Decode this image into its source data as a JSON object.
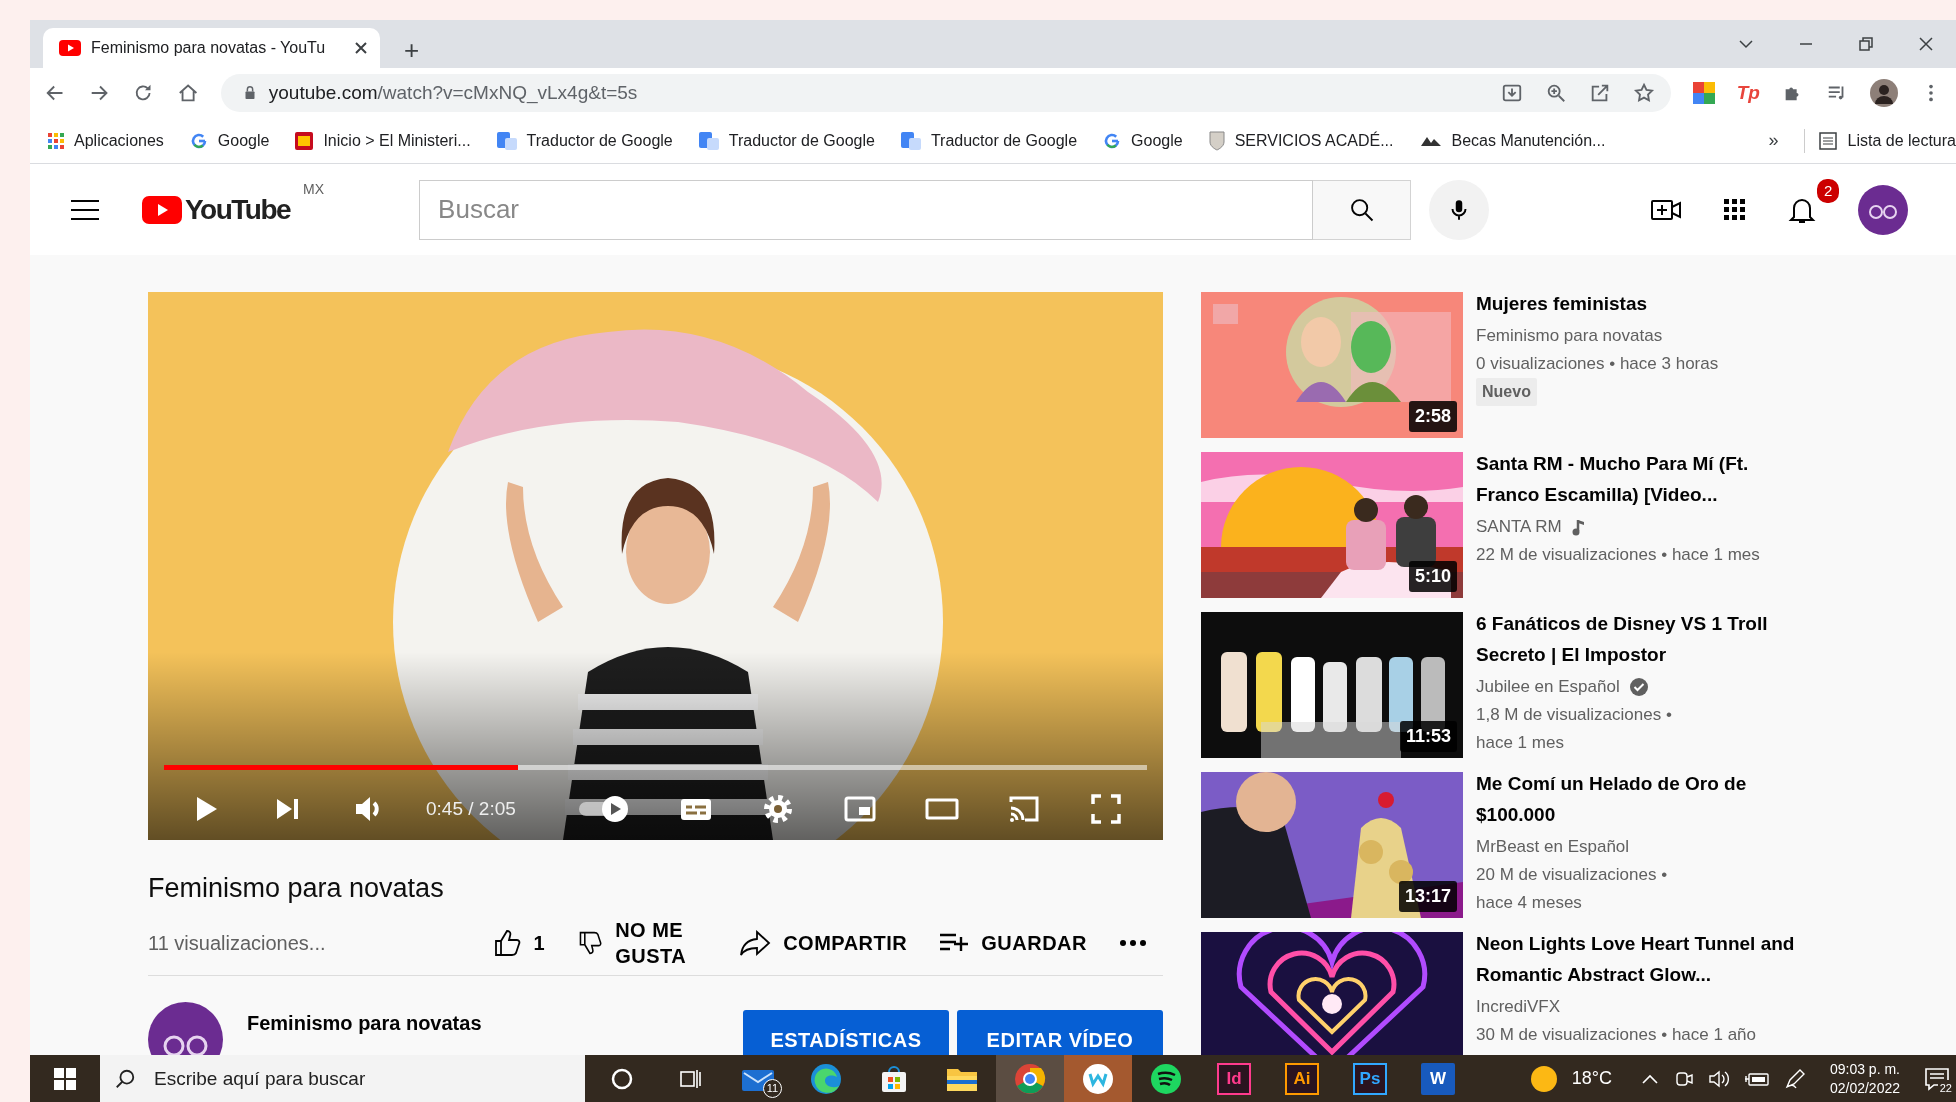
{
  "browser": {
    "tabs": [
      {
        "title": "Feminismo para novatas - YouTu",
        "selected": true
      }
    ],
    "new_tab": "+",
    "address": {
      "host": "youtube.com",
      "path": "/watch?v=cMxNQ_vLx4g&t=5s"
    },
    "extensions": [
      {
        "kind": "colors"
      },
      {
        "kind": "tp",
        "label": "Tp"
      },
      {
        "kind": "puzzle"
      },
      {
        "kind": "media"
      },
      {
        "kind": "avatar"
      }
    ],
    "bookmarks": [
      {
        "kind": "apps",
        "label": "Aplicaciones"
      },
      {
        "kind": "g",
        "label": "Google"
      },
      {
        "kind": "flag",
        "label": "Inicio > El Ministeri..."
      },
      {
        "kind": "doc",
        "label": "Traductor de Google"
      },
      {
        "kind": "doc",
        "label": "Traductor de Google"
      },
      {
        "kind": "doc",
        "label": "Traductor de Google"
      },
      {
        "kind": "g",
        "label": "Google"
      },
      {
        "kind": "crest",
        "label": "SERVICIOS ACADÉ..."
      },
      {
        "kind": "emblem",
        "label": "Becas Manutención..."
      }
    ],
    "more_bookmarks": "»",
    "reading_list": "Lista de lectura"
  },
  "youtube": {
    "logo": "YouTube",
    "region": "MX",
    "search": {
      "placeholder": "Buscar"
    },
    "notifications": "2"
  },
  "player": {
    "level": 0.36,
    "time": "0:45 / 2:05",
    "autoplay": true
  },
  "video": {
    "title": "Feminismo para novatas",
    "views": "11 visualizaciones...",
    "likes": "1",
    "dislike": "NO ME GUSTA",
    "share": "COMPARTIR",
    "save": "GUARDAR",
    "channel": "Feminismo para novatas",
    "buttons": [
      "ESTADÍSTICAS",
      "EDITAR VÍDEO"
    ]
  },
  "sidebar": [
    {
      "duration": "2:58",
      "title": "Mujeres feministas",
      "channel": "Feminismo para novatas",
      "kind": "plain",
      "meta": [
        "0 visualizaciones • hace 3 horas"
      ],
      "badge": "Nuevo"
    },
    {
      "duration": "5:10",
      "title": "Santa RM - Mucho Para Mí (Ft. Franco Escamilla) [Video...",
      "channel": "SANTA RM",
      "kind": "music",
      "meta": [
        "22 M de visualizaciones • hace 1 mes"
      ]
    },
    {
      "duration": "11:53",
      "title": "6 Fanáticos de Disney VS 1 Troll Secreto | El Impostor",
      "channel": "Jubilee en Español",
      "kind": "verified",
      "meta": [
        "1,8 M de visualizaciones •",
        "hace 1 mes"
      ]
    },
    {
      "duration": "13:17",
      "title": "Me Comí un Helado de Oro de $100.000",
      "channel": "MrBeast en Español",
      "kind": "plain",
      "meta": [
        "20 M de visualizaciones •",
        "hace 4 meses"
      ]
    },
    {
      "title": "Neon Lights Love Heart Tunnel and Romantic Abstract Glow...",
      "channel": "IncrediVFX",
      "kind": "plain",
      "meta": [
        "30 M de visualizaciones • hace 1 año"
      ]
    }
  ],
  "taskbar": {
    "search": {
      "placeholder": "Escribe aquí para buscar"
    },
    "apps": [
      {
        "kind": "cortana",
        "active": false
      },
      {
        "kind": "taskview",
        "active": false
      },
      {
        "kind": "mail",
        "badge": "11",
        "active": false
      },
      {
        "kind": "edge",
        "active": false
      },
      {
        "kind": "store",
        "active": false
      },
      {
        "kind": "folder",
        "active": false
      },
      {
        "kind": "chrome",
        "active": true
      },
      {
        "kind": "wattpad",
        "active": true
      },
      {
        "kind": "spotify",
        "active": false
      },
      {
        "kind": "tile",
        "label": "Id",
        "color": "#ff3b8d",
        "active": false
      },
      {
        "kind": "tile",
        "label": "Ai",
        "color": "#ff9a00",
        "active": false
      },
      {
        "kind": "tile",
        "label": "Ps",
        "color": "#31a8ff",
        "active": false
      },
      {
        "kind": "word",
        "label": "W",
        "active": false
      }
    ],
    "temperature": "18°C",
    "time": "09:03 p. m.",
    "date": "02/02/2022",
    "notifications": "22"
  }
}
